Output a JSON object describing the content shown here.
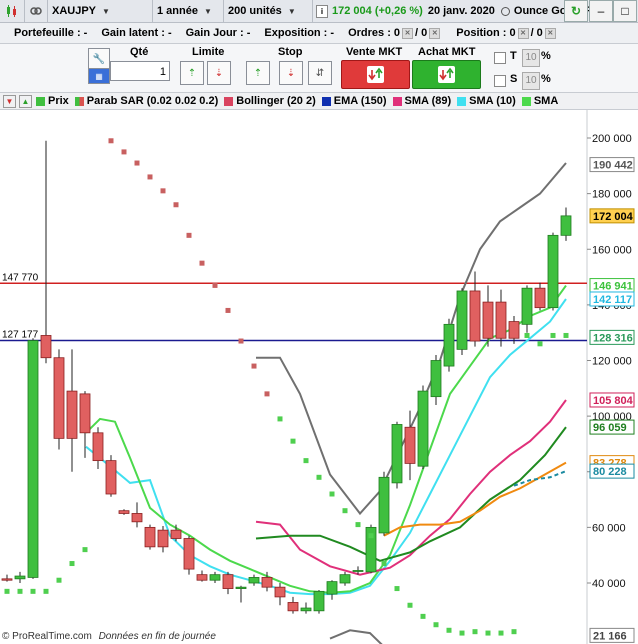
{
  "toolbar": {
    "symbol": "XAUJPY",
    "period": "1 année",
    "units": "200 unités",
    "price_change": "172 004 (+0,26 %)",
    "date": "20 janv. 2020",
    "instrument_name": "Ounce Gold JPY"
  },
  "info": {
    "portefeuille": "Portefeuille : -",
    "gain_latent": "Gain latent : -",
    "gain_jour": "Gain Jour : -",
    "exposition": "Exposition : -",
    "ordres": "Ordres : 0",
    "ordres_slash": "/ 0",
    "position": "Position : 0",
    "position_slash": "/ 0"
  },
  "order": {
    "qty_label": "Qté",
    "qty_value": "1",
    "limit_label": "Limite",
    "stop_label": "Stop",
    "sell_label": "Vente MKT",
    "buy_label": "Achat MKT",
    "t_label": "T",
    "s_label": "S",
    "t_pct": "10",
    "s_pct": "10",
    "pct_sign": "%"
  },
  "legend": [
    {
      "label": "Prix",
      "color": "#3fbf3f"
    },
    {
      "label": "Parab SAR (0.02 0.02 0.2)",
      "color": "#d9534f"
    },
    {
      "label": "Bollinger (20 2)",
      "color": "#d9435f"
    },
    {
      "label": "EMA (150)",
      "color": "#1030b0"
    },
    {
      "label": "SMA (89)",
      "color": "#e0307a"
    },
    {
      "label": "SMA (10)",
      "color": "#40e0f0"
    },
    {
      "label": "SMA",
      "color": "#4cd94c"
    }
  ],
  "chart_data": {
    "type": "candlestick",
    "ylim": [
      21166,
      212000
    ],
    "y_ticks": [
      40000,
      60000,
      80000,
      100000,
      120000,
      140000,
      160000,
      180000,
      200000
    ],
    "y_tick_labels": [
      "40 000",
      "60 000",
      "80 000",
      "100 000",
      "120 000",
      "140 000",
      "160 000",
      "180 000",
      "200 000"
    ],
    "horizontal_lines": [
      {
        "value": 147770,
        "label": "147 770",
        "color": "#d02020"
      },
      {
        "value": 127177,
        "label": "127 177",
        "color": "#1a1a90"
      }
    ],
    "price_badges": [
      {
        "value": 190442,
        "label": "190 442",
        "bg": "#ffffff",
        "fg": "#555555",
        "border": "#888888"
      },
      {
        "value": 172004,
        "label": "172 004",
        "bg": "#ffd050",
        "fg": "#000000",
        "border": "#c09000"
      },
      {
        "value": 146941,
        "label": "146 941",
        "bg": "#ffffff",
        "fg": "#3cc23c",
        "border": "#3cc23c"
      },
      {
        "value": 142117,
        "label": "142 117",
        "bg": "#ffffff",
        "fg": "#20b8e0",
        "border": "#20b8e0"
      },
      {
        "value": 128316,
        "label": "128 316",
        "bg": "#ffffff",
        "fg": "#2a9a5a",
        "border": "#2a9a5a"
      },
      {
        "value": 105804,
        "label": "105 804",
        "bg": "#ffffff",
        "fg": "#d0205a",
        "border": "#d0205a"
      },
      {
        "value": 96059,
        "label": "96 059",
        "bg": "#ffffff",
        "fg": "#208020",
        "border": "#208020"
      },
      {
        "value": 83278,
        "label": "83 278",
        "bg": "#ffffff",
        "fg": "#e08a10",
        "border": "#e08a10"
      },
      {
        "value": 80228,
        "label": "80 228",
        "bg": "#ffffff",
        "fg": "#1a8aa0",
        "border": "#1a8aa0"
      },
      {
        "value": 21166,
        "label": "21 166",
        "bg": "#ffffff",
        "fg": "#444444",
        "border": "#888888"
      }
    ],
    "candles": [
      {
        "x": 7,
        "open": 41500,
        "high": 43000,
        "low": 40500,
        "close": 41000
      },
      {
        "x": 20,
        "open": 41500,
        "high": 44000,
        "low": 40000,
        "close": 42500
      },
      {
        "x": 33,
        "open": 42000,
        "high": 128000,
        "low": 41500,
        "close": 127177
      },
      {
        "x": 46,
        "open": 129000,
        "high": 199000,
        "low": 119000,
        "close": 121000
      },
      {
        "x": 59,
        "open": 121000,
        "high": 124000,
        "low": 88000,
        "close": 92000
      },
      {
        "x": 72,
        "open": 109000,
        "high": 124000,
        "low": 80000,
        "close": 92000
      },
      {
        "x": 85,
        "open": 108000,
        "high": 109000,
        "low": 85000,
        "close": 94000
      },
      {
        "x": 98,
        "open": 94000,
        "high": 96000,
        "low": 81000,
        "close": 84000
      },
      {
        "x": 111,
        "open": 84000,
        "high": 86000,
        "low": 71000,
        "close": 72000
      },
      {
        "x": 124,
        "open": 66000,
        "high": 66500,
        "low": 64500,
        "close": 65000
      },
      {
        "x": 137,
        "open": 65000,
        "high": 69000,
        "low": 60000,
        "close": 62000
      },
      {
        "x": 150,
        "open": 60000,
        "high": 61000,
        "low": 52000,
        "close": 53000
      },
      {
        "x": 163,
        "open": 59000,
        "high": 60500,
        "low": 51000,
        "close": 53000
      },
      {
        "x": 176,
        "open": 59000,
        "high": 61000,
        "low": 55000,
        "close": 56000
      },
      {
        "x": 189,
        "open": 56000,
        "high": 57000,
        "low": 43000,
        "close": 45000
      },
      {
        "x": 202,
        "open": 43000,
        "high": 44500,
        "low": 40500,
        "close": 41000
      },
      {
        "x": 215,
        "open": 41000,
        "high": 44000,
        "low": 40000,
        "close": 43000
      },
      {
        "x": 228,
        "open": 43000,
        "high": 44000,
        "low": 36000,
        "close": 38000
      },
      {
        "x": 241,
        "open": 38000,
        "high": 39000,
        "low": 33000,
        "close": 38500
      },
      {
        "x": 254,
        "open": 40000,
        "high": 43000,
        "low": 39000,
        "close": 42000
      },
      {
        "x": 267,
        "open": 42000,
        "high": 44000,
        "low": 37000,
        "close": 38500
      },
      {
        "x": 280,
        "open": 38500,
        "high": 40000,
        "low": 32000,
        "close": 35000
      },
      {
        "x": 293,
        "open": 33000,
        "high": 35000,
        "low": 29000,
        "close": 30000
      },
      {
        "x": 306,
        "open": 30000,
        "high": 33000,
        "low": 29000,
        "close": 31000
      },
      {
        "x": 319,
        "open": 30000,
        "high": 37500,
        "low": 29000,
        "close": 37000
      },
      {
        "x": 332,
        "open": 36000,
        "high": 41000,
        "low": 34000,
        "close": 40500
      },
      {
        "x": 345,
        "open": 40000,
        "high": 44000,
        "low": 39000,
        "close": 43000
      },
      {
        "x": 358,
        "open": 44500,
        "high": 46000,
        "low": 43000,
        "close": 44500
      },
      {
        "x": 371,
        "open": 44000,
        "high": 61000,
        "low": 43500,
        "close": 60000
      },
      {
        "x": 384,
        "open": 58000,
        "high": 80000,
        "low": 57000,
        "close": 78000
      },
      {
        "x": 397,
        "open": 76000,
        "high": 98000,
        "low": 74000,
        "close": 97000
      },
      {
        "x": 410,
        "open": 96000,
        "high": 102000,
        "low": 77000,
        "close": 83000
      },
      {
        "x": 423,
        "open": 82000,
        "high": 111000,
        "low": 81000,
        "close": 109000
      },
      {
        "x": 436,
        "open": 107000,
        "high": 122000,
        "low": 104000,
        "close": 120000
      },
      {
        "x": 449,
        "open": 118000,
        "high": 135000,
        "low": 116000,
        "close": 133000
      },
      {
        "x": 462,
        "open": 124000,
        "high": 146000,
        "low": 122000,
        "close": 145000
      },
      {
        "x": 475,
        "open": 145000,
        "high": 152000,
        "low": 125000,
        "close": 127000
      },
      {
        "x": 488,
        "open": 141000,
        "high": 147000,
        "low": 125000,
        "close": 128000
      },
      {
        "x": 501,
        "open": 141000,
        "high": 145500,
        "low": 125000,
        "close": 128000
      },
      {
        "x": 514,
        "open": 134000,
        "high": 136000,
        "low": 126000,
        "close": 128000
      },
      {
        "x": 527,
        "open": 133000,
        "high": 147000,
        "low": 130000,
        "close": 146000
      },
      {
        "x": 540,
        "open": 146000,
        "high": 148000,
        "low": 138000,
        "close": 139000
      },
      {
        "x": 553,
        "open": 139000,
        "high": 166000,
        "low": 138000,
        "close": 165000
      },
      {
        "x": 566,
        "open": 165000,
        "high": 175000,
        "low": 163000,
        "close": 172004
      }
    ],
    "sar_points": [
      [
        7,
        37000
      ],
      [
        20,
        37000
      ],
      [
        33,
        37000
      ],
      [
        46,
        37000
      ],
      [
        59,
        41000
      ],
      [
        72,
        47000
      ],
      [
        85,
        52000
      ],
      [
        111,
        199000
      ],
      [
        124,
        195000
      ],
      [
        137,
        191000
      ],
      [
        150,
        186000
      ],
      [
        163,
        181000
      ],
      [
        176,
        176000
      ],
      [
        189,
        165000
      ],
      [
        202,
        155000
      ],
      [
        215,
        147000
      ],
      [
        228,
        138000
      ],
      [
        241,
        127000
      ],
      [
        254,
        118000
      ],
      [
        267,
        108000
      ],
      [
        280,
        99000
      ],
      [
        293,
        91000
      ],
      [
        306,
        84000
      ],
      [
        319,
        78000
      ],
      [
        332,
        72000
      ],
      [
        345,
        66000
      ],
      [
        358,
        61000
      ],
      [
        371,
        57000
      ],
      [
        384,
        47000
      ],
      [
        397,
        38000
      ],
      [
        410,
        32000
      ],
      [
        423,
        28000
      ],
      [
        436,
        25000
      ],
      [
        449,
        23000
      ],
      [
        462,
        22000
      ],
      [
        475,
        22500
      ],
      [
        488,
        22000
      ],
      [
        501,
        22000
      ],
      [
        514,
        22500
      ],
      [
        527,
        129000
      ],
      [
        540,
        126000
      ],
      [
        553,
        129000
      ],
      [
        566,
        129000
      ]
    ],
    "series": [
      {
        "name": "Bollinger upper",
        "color": "#707070",
        "width": 2,
        "points": [
          [
            256,
            121000
          ],
          [
            280,
            121000
          ],
          [
            300,
            108000
          ],
          [
            330,
            79000
          ],
          [
            360,
            65000
          ],
          [
            380,
            73000
          ],
          [
            400,
            88000
          ],
          [
            420,
            103000
          ],
          [
            440,
            120000
          ],
          [
            460,
            143000
          ],
          [
            480,
            160000
          ],
          [
            500,
            170000
          ],
          [
            520,
            175000
          ],
          [
            540,
            180000
          ],
          [
            566,
            191000
          ]
        ]
      },
      {
        "name": "Bollinger lower",
        "color": "#707070",
        "width": 2,
        "points": [
          [
            330,
            20000
          ],
          [
            350,
            23000
          ],
          [
            370,
            22000
          ],
          [
            390,
            15000
          ],
          [
            410,
            10000
          ]
        ]
      },
      {
        "name": "SMA (10)",
        "color": "#40e0f0",
        "width": 2,
        "points": [
          [
            86,
            89000
          ],
          [
            110,
            82000
          ],
          [
            130,
            76000
          ],
          [
            150,
            77000
          ],
          [
            170,
            57000
          ],
          [
            190,
            50000
          ],
          [
            210,
            46000
          ],
          [
            230,
            43000
          ],
          [
            250,
            41000
          ],
          [
            270,
            39000
          ],
          [
            290,
            36500
          ],
          [
            310,
            36000
          ],
          [
            330,
            36000
          ],
          [
            350,
            36500
          ],
          [
            370,
            39000
          ],
          [
            390,
            48000
          ],
          [
            410,
            58000
          ],
          [
            430,
            72000
          ],
          [
            450,
            86000
          ],
          [
            470,
            100000
          ],
          [
            490,
            114000
          ],
          [
            510,
            122000
          ],
          [
            530,
            128000
          ],
          [
            550,
            134000
          ],
          [
            566,
            142117
          ]
        ]
      },
      {
        "name": "SMA",
        "color": "#4cd94c",
        "width": 2,
        "points": [
          [
            86,
            94000
          ],
          [
            100,
            99000
          ],
          [
            115,
            98000
          ],
          [
            130,
            85000
          ],
          [
            150,
            67000
          ],
          [
            170,
            61000
          ],
          [
            190,
            57000
          ],
          [
            210,
            52000
          ],
          [
            230,
            48000
          ],
          [
            250,
            45000
          ],
          [
            270,
            42000
          ],
          [
            290,
            39000
          ],
          [
            310,
            37000
          ],
          [
            330,
            36500
          ],
          [
            350,
            37000
          ],
          [
            370,
            40000
          ],
          [
            390,
            50000
          ],
          [
            410,
            68000
          ],
          [
            430,
            88000
          ],
          [
            450,
            108000
          ],
          [
            470,
            118000
          ],
          [
            490,
            128000
          ],
          [
            510,
            131000
          ],
          [
            530,
            136000
          ],
          [
            550,
            139000
          ],
          [
            566,
            146941
          ]
        ]
      },
      {
        "name": "SMA (89)",
        "color": "#e0307a",
        "width": 2,
        "points": [
          [
            256,
            62000
          ],
          [
            280,
            61000
          ],
          [
            300,
            52000
          ],
          [
            330,
            46000
          ],
          [
            360,
            43000
          ],
          [
            390,
            45500
          ],
          [
            410,
            50000
          ],
          [
            430,
            57000
          ],
          [
            450,
            63000
          ],
          [
            470,
            72000
          ],
          [
            490,
            80000
          ],
          [
            510,
            86000
          ],
          [
            530,
            91000
          ],
          [
            550,
            98000
          ],
          [
            566,
            105804
          ]
        ]
      },
      {
        "name": "EMA (150)",
        "color": "#208a20",
        "width": 2,
        "points": [
          [
            256,
            56000
          ],
          [
            290,
            57000
          ],
          [
            320,
            57000
          ],
          [
            350,
            53000
          ],
          [
            380,
            48000
          ],
          [
            410,
            51000
          ],
          [
            430,
            55000
          ],
          [
            460,
            60000
          ],
          [
            490,
            70000
          ],
          [
            520,
            77000
          ],
          [
            545,
            86000
          ],
          [
            566,
            96059
          ]
        ]
      },
      {
        "name": "SMA orange",
        "color": "#f08a10",
        "width": 2,
        "points": [
          [
            384,
            57000
          ],
          [
            400,
            60000
          ],
          [
            420,
            61000
          ],
          [
            440,
            61000
          ],
          [
            460,
            62000
          ],
          [
            480,
            66000
          ],
          [
            500,
            71000
          ],
          [
            520,
            74000
          ],
          [
            540,
            78000
          ],
          [
            566,
            83278
          ]
        ]
      },
      {
        "name": "SMA dashed",
        "color": "#1a8aa0",
        "width": 2,
        "dashed": true,
        "points": [
          [
            514,
            75000
          ],
          [
            530,
            77000
          ],
          [
            550,
            78000
          ],
          [
            566,
            80228
          ]
        ]
      }
    ]
  },
  "footer": {
    "brand": "© ProRealTime.com",
    "note": "Données en fin de journée"
  }
}
